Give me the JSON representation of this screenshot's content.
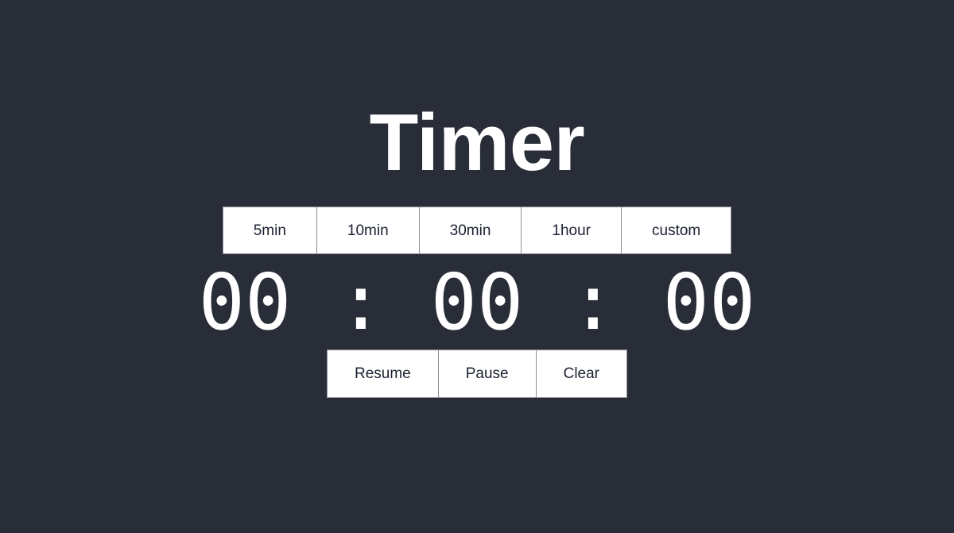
{
  "app": {
    "title": "Timer",
    "background_color": "#282d37",
    "text_color": "#ffffff",
    "button_background": "#ffffff",
    "button_text_color": "#1b2030",
    "button_border_color": "#8e8e93"
  },
  "presets": [
    {
      "label": "5min"
    },
    {
      "label": "10min"
    },
    {
      "label": "30min"
    },
    {
      "label": "1hour"
    },
    {
      "label": "custom"
    }
  ],
  "display": {
    "value": "00 : 00 : 00",
    "hours": "00",
    "minutes": "00",
    "seconds": "00",
    "separator": ":"
  },
  "controls": [
    {
      "label": "Resume"
    },
    {
      "label": "Pause"
    },
    {
      "label": "Clear"
    }
  ]
}
